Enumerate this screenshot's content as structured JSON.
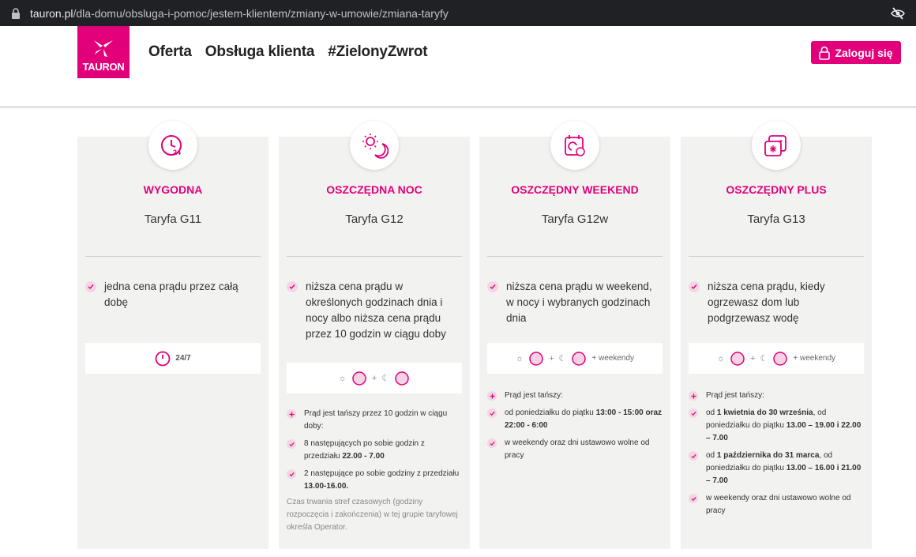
{
  "browser": {
    "url_domain": "tauron.pl",
    "url_path": "/dla-domu/obsluga-i-pomoc/jestem-klientem/zmiany-w-umowie/zmiana-taryfy"
  },
  "header": {
    "logo_text": "TAURON",
    "nav": [
      "Oferta",
      "Obsługa klienta",
      "#ZielonyZwrot"
    ],
    "login_label": "Zaloguj się"
  },
  "colors": {
    "accent": "#e2007a",
    "card_bg": "#f2f2f0",
    "check_bg": "#f3d6e4"
  },
  "cards": [
    {
      "icon": "clock-24-icon",
      "title": "WYGODNA",
      "subtitle": "Taryfa G11",
      "feature": "jedna cena prądu przez całą dobę",
      "badge": "24/7"
    },
    {
      "icon": "sun-moon-icon",
      "title": "OSZCZĘDNA NOC",
      "subtitle": "Taryfa G12",
      "feature": "niższa cena prądu w określonych godzinach dnia i nocy albo niższa cena prądu przez 10 godzin w ciągu doby",
      "details": [
        {
          "mark": "plus",
          "text": "Prąd jest tańszy przez 10 godzin w ciągu doby:"
        },
        {
          "mark": "check",
          "text": "8 następujących po sobie godzin z przedziału",
          "bold": "22.00 - 7.00"
        },
        {
          "mark": "check",
          "text": "2 następujące po sobie godziny z przedziału",
          "bold": "13.00-16.00."
        }
      ],
      "note": "Czas trwania stref czasowych (godziny rozpoczęcia i zakończenia) w tej grupie taryfowej określa Operator."
    },
    {
      "icon": "calendar-icon",
      "title": "OSZCZĘDNY WEEKEND",
      "subtitle": "Taryfa G12w",
      "feature": "niższa cena prądu w weekend, w nocy i wybranych godzinach dnia",
      "badge_extra": "+ weekendy",
      "details": [
        {
          "mark": "plus",
          "text": "Prąd jest tańszy:"
        },
        {
          "mark": "check",
          "text": "od poniedziałku do piątku",
          "bold": "13:00 - 15:00 oraz 22:00 - 6:00"
        },
        {
          "mark": "check",
          "text": "w weekendy oraz dni ustawowo wolne od pracy"
        }
      ]
    },
    {
      "icon": "calendar-snow-icon",
      "title": "OSZCZĘDNY PLUS",
      "subtitle": "Taryfa G13",
      "feature": "niższa cena prądu, kiedy ogrzewasz dom lub podgrzewasz wodę",
      "badge_extra": "+ weekendy",
      "details": [
        {
          "mark": "plus",
          "text": "Prąd jest tańszy:"
        },
        {
          "mark": "check",
          "pre": "od",
          "b1": "1 kwietnia do 30 września",
          "mid": ", od poniedziałku do piątku",
          "b2": "13.00 – 19.00 i 22.00 – 7.00"
        },
        {
          "mark": "check",
          "pre": "od",
          "b1": "1 października do 31 marca",
          "mid": ", od poniedziałku do piątku",
          "b2": "13.00 – 16.00 i 21.00 – 7.00"
        },
        {
          "mark": "check",
          "text": "w weekendy oraz dni ustawowo wolne od pracy"
        }
      ]
    }
  ]
}
